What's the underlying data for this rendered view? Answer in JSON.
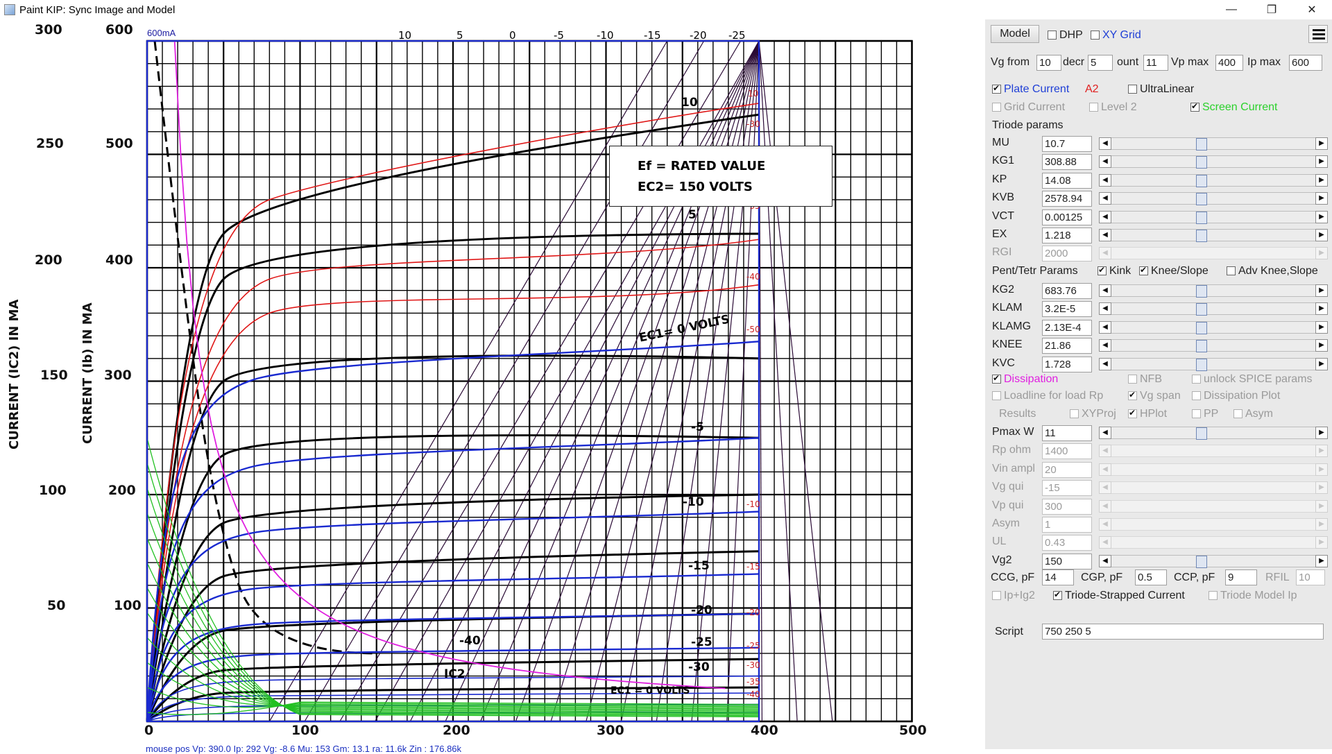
{
  "window": {
    "title": "Paint KIP: Sync Image and Model",
    "minimize": "—",
    "restore": "❐",
    "close": "✕"
  },
  "plot": {
    "scale_label": "600mA",
    "y_left_ticks": [
      "300",
      "250",
      "200",
      "150",
      "100",
      "50"
    ],
    "y_right_ticks": [
      "600",
      "500",
      "400",
      "300",
      "200",
      "100"
    ],
    "x_ticks": [
      "0",
      "100",
      "200",
      "300",
      "400",
      "500"
    ],
    "y_label_left": "CURRENT (IC2) IN MA",
    "y_label_right": "CURRENT (Ib) IN MA",
    "vg_top_labels": [
      "10",
      "5",
      "0",
      "-5",
      "-10",
      "-15",
      "-20",
      "-25"
    ],
    "vg_right_labels": [
      "10",
      "-30",
      "-35",
      "-40",
      "-50",
      "-10",
      "-15",
      "-20",
      "-25",
      "-30",
      "-35",
      "-40"
    ],
    "info_box": [
      "Ef = RATED VALUE",
      "EC2= 150 VOLTS"
    ],
    "curve_labels": [
      "10",
      "5",
      "EC1= 0 VOLTS",
      "-5",
      "-10",
      "-15",
      "-20",
      "-25",
      "-30",
      "-40",
      "IC2",
      "EC1 = 0 VOLTS"
    ],
    "status": "mouse pos Vp: 390.0  Ip: 292      Vg: -8.6     Mu: 153      Gm: 13.1     ra: 11.6k    Zin       : 176.86k"
  },
  "panel": {
    "model_button": "Model",
    "dhp": "DHP",
    "xy_grid": "XY Grid",
    "vg_from_label": "Vg from",
    "vg_from": "10",
    "decr_label": "decr",
    "decr": "5",
    "count_label": "ount",
    "count": "11",
    "vp_max_label": "Vp max",
    "vp_max": "400",
    "ip_max_label": "Ip max",
    "ip_max": "600",
    "plate_current": "Plate Current",
    "a2": "A2",
    "ultralinear": "UltraLinear",
    "grid_current": "Grid Current",
    "level2": "Level 2",
    "screen_current": "Screen Current",
    "triode_params": "Triode params",
    "triode": [
      {
        "name": "MU",
        "value": "10.7"
      },
      {
        "name": "KG1",
        "value": "308.88"
      },
      {
        "name": "KP",
        "value": "14.08"
      },
      {
        "name": "KVB",
        "value": "2578.94"
      },
      {
        "name": "VCT",
        "value": "0.00125"
      },
      {
        "name": "EX",
        "value": "1.218"
      },
      {
        "name": "RGI",
        "value": "2000"
      }
    ],
    "pent_params": "Pent/Tetr Params",
    "kink": "Kink",
    "knee_slope": "Knee/Slope",
    "adv_knee": "Adv Knee,Slope",
    "pent": [
      {
        "name": "KG2",
        "value": "683.76"
      },
      {
        "name": "KLAM",
        "value": "3.2E-5"
      },
      {
        "name": "KLAMG",
        "value": "2.13E-4"
      },
      {
        "name": "KNEE",
        "value": "21.86"
      },
      {
        "name": "KVC",
        "value": "1.728"
      }
    ],
    "dissipation": "Dissipation",
    "nfb": "NFB",
    "unlock_spice": "unlock SPICE params",
    "loadline": "Loadline for load Rp",
    "vg_span": "Vg span",
    "dissipation_plot": "Dissipation Plot",
    "results": "Results",
    "xyproj": "XYProj",
    "hplot": "HPlot",
    "pp": "PP",
    "asym_chk": "Asym",
    "load": [
      {
        "name": "Pmax W",
        "value": "11"
      },
      {
        "name": "Rp ohm",
        "value": "1400"
      },
      {
        "name": "Vin ampl",
        "value": "20"
      },
      {
        "name": "Vg qui",
        "value": "-15"
      },
      {
        "name": "Vp qui",
        "value": "300"
      },
      {
        "name": "Asym",
        "value": "1"
      },
      {
        "name": "UL",
        "value": "0.43"
      },
      {
        "name": "Vg2",
        "value": "150"
      }
    ],
    "ccg_label": "CCG, pF",
    "ccg": "14",
    "cgp_label": "CGP, pF",
    "cgp": "0.5",
    "ccp_label": "CCP, pF",
    "ccp": "9",
    "rfil_label": "RFIL",
    "rfil": "10",
    "ip_ig2": "Ip+Ig2",
    "triode_strapped": "Triode-Strapped Current",
    "triode_model_ip": "Triode Model Ip",
    "script_label": "Script",
    "script": "750 250 5"
  }
}
